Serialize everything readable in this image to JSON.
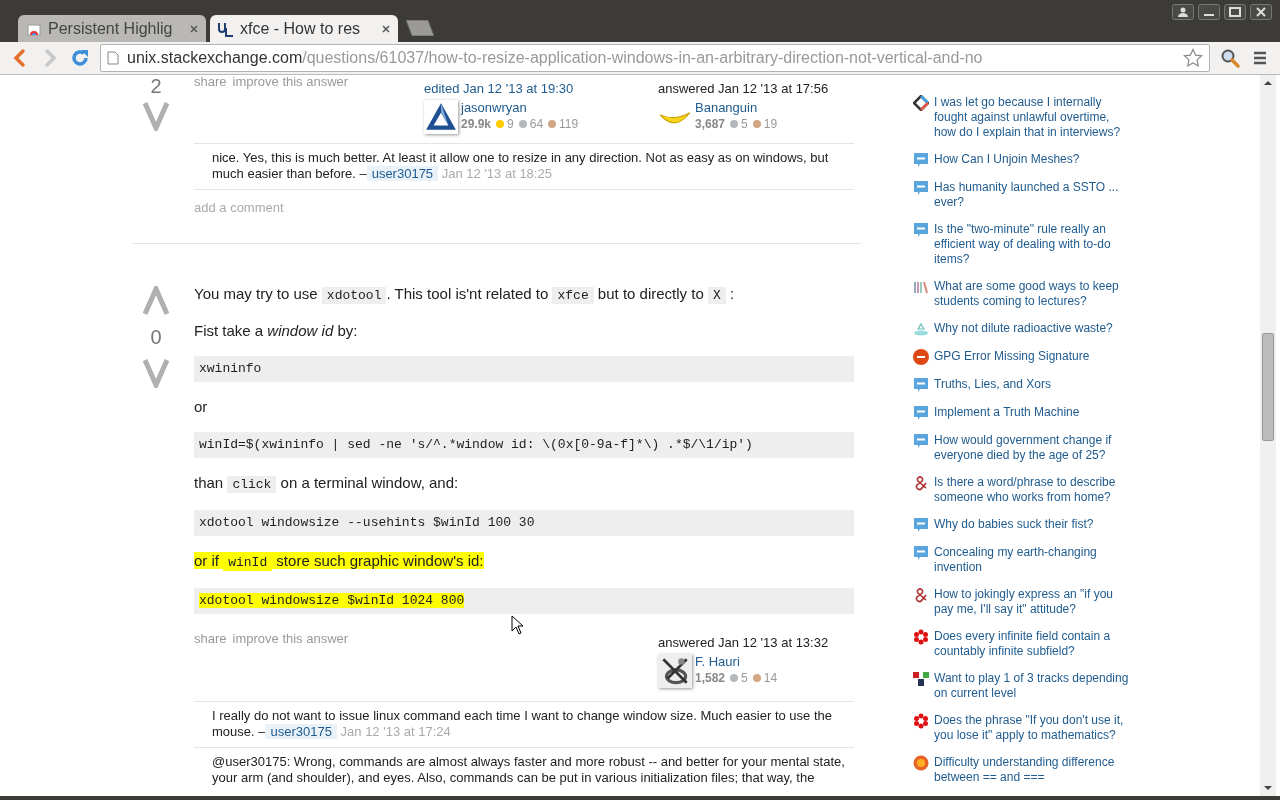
{
  "browser": {
    "tabs": [
      {
        "title": "Persistent Highlig",
        "selected": false
      },
      {
        "title": "xfce - How to res",
        "selected": true
      }
    ],
    "url_host": "unix.stackexchange.com",
    "url_path": "/questions/61037/how-to-resize-application-windows-in-an-arbitrary-direction-not-vertical-and-no"
  },
  "answers": [
    {
      "score": "2",
      "links": [
        "share",
        "improve this answer"
      ],
      "signatures": [
        {
          "action": "edited Jan 12 '13 at 19:30",
          "kind": "edit",
          "user": "jasonwryan",
          "rep": "29.9k",
          "badges": [
            {
              "count": "9",
              "color": "#ffcc01"
            },
            {
              "count": "64",
              "color": "#b4b8bc"
            },
            {
              "count": "119",
              "color": "#d1a684"
            }
          ]
        },
        {
          "action": "answered Jan 12 '13 at 17:56",
          "kind": "answer",
          "user": "Bananguin",
          "rep": "3,687",
          "badges": [
            {
              "count": "5",
              "color": "#b4b8bc"
            },
            {
              "count": "19",
              "color": "#d1a684"
            }
          ]
        }
      ],
      "comments": [
        {
          "text": "nice. Yes, this is much better. At least it allow one to resize in any direction. Not as easy as on windows, but much easier than before. –",
          "user": "user30175",
          "date": "Jan 12 '13 at 18:25"
        }
      ],
      "add_comment": "add a comment"
    },
    {
      "score": "0",
      "links": [
        "share",
        "improve this answer"
      ],
      "blocks": [
        {
          "kind": "para",
          "highlighted": false,
          "parts": [
            {
              "kind": "text",
              "text": "You may try to use "
            },
            {
              "kind": "code",
              "text": "xdotool"
            },
            {
              "kind": "text",
              "text": ". This tool is'nt related to "
            },
            {
              "kind": "code",
              "text": "xfce"
            },
            {
              "kind": "text",
              "text": " but to directly to "
            },
            {
              "kind": "code",
              "text": "X"
            },
            {
              "kind": "text",
              "text": " :"
            }
          ]
        },
        {
          "kind": "para",
          "highlighted": false,
          "parts": [
            {
              "kind": "text",
              "text": "Fist take a "
            },
            {
              "kind": "em",
              "text": "window id"
            },
            {
              "kind": "text",
              "text": " by:"
            }
          ]
        },
        {
          "kind": "code",
          "highlighted": false,
          "text": "xwininfo"
        },
        {
          "kind": "para",
          "highlighted": false,
          "parts": [
            {
              "kind": "text",
              "text": "or"
            }
          ]
        },
        {
          "kind": "code",
          "highlighted": false,
          "text": "winId=$(xwininfo | sed -ne 's/^.*window id: \\(0x[0-9a-f]*\\) .*$/\\1/ip')"
        },
        {
          "kind": "para",
          "highlighted": false,
          "parts": [
            {
              "kind": "text",
              "text": "than "
            },
            {
              "kind": "code",
              "text": "click"
            },
            {
              "kind": "text",
              "text": " on a terminal window, and:"
            }
          ]
        },
        {
          "kind": "code",
          "highlighted": false,
          "text": "xdotool windowsize --usehints $winId 100 30"
        },
        {
          "kind": "para",
          "highlighted": true,
          "parts": [
            {
              "kind": "text",
              "text": "or if "
            },
            {
              "kind": "code",
              "text": "winId"
            },
            {
              "kind": "text",
              "text": " store such graphic window's id:"
            }
          ]
        },
        {
          "kind": "code",
          "highlighted": true,
          "text": "xdotool windowsize $winId 1024 800"
        }
      ],
      "signatures": [
        {
          "action": "answered Jan 12 '13 at 13:32",
          "kind": "answer",
          "user": "F. Hauri",
          "rep": "1,582",
          "badges": [
            {
              "count": "5",
              "color": "#b4b8bc"
            },
            {
              "count": "14",
              "color": "#d1a684"
            }
          ]
        }
      ],
      "comments": [
        {
          "text": "I really do not want to issue linux command each time I want to change window size. Much easier to use the mouse. –",
          "user": "user30175",
          "date": "Jan 12 '13 at 17:24"
        },
        {
          "text": "@user30175: Wrong, commands are almost always faster and more robust -- and better for your mental state, your arm (and shoulder), and eyes. Also, commands can be put in various initialization files; that way, the"
        }
      ]
    }
  ],
  "hot_questions": [
    {
      "title": "I was let go because I internally fought against unlawful overtime, how do I explain that in interviews?",
      "kind": "diamond"
    },
    {
      "title": "How Can I Unjoin Meshes?",
      "kind": "bubble"
    },
    {
      "title": "Has humanity launched a SSTO ... ever?",
      "kind": "bubble"
    },
    {
      "title": "Is the \"two-minute\" rule really an efficient way of dealing with to-do items?",
      "kind": "bubble"
    },
    {
      "title": "What are some good ways to keep students coming to lectures?",
      "kind": "books"
    },
    {
      "title": "Why not dilute radioactive waste?",
      "kind": "drop"
    },
    {
      "title": "GPG Error Missing Signature",
      "kind": "circle"
    },
    {
      "title": "Truths, Lies, and Xors",
      "kind": "bubble"
    },
    {
      "title": "Implement a Truth Machine",
      "kind": "bubble"
    },
    {
      "title": "How would government change if everyone died by the age of 25?",
      "kind": "bubble"
    },
    {
      "title": "Is there a word/phrase to describe someone who works from home?",
      "kind": "ampersand"
    },
    {
      "title": "Why do babies suck their fist?",
      "kind": "bubble"
    },
    {
      "title": "Concealing my earth-changing invention",
      "kind": "bubble"
    },
    {
      "title": "How to jokingly express an \"if you pay me, I'll say it\" attitude?",
      "kind": "ampersand"
    },
    {
      "title": "Does every infinite field contain a countably infinite subfield?",
      "kind": "flower"
    },
    {
      "title": "Want to play 1 of 3 tracks depending on current level",
      "kind": "cubes"
    },
    {
      "title": "Does the phrase \"If you don't use it, you lose it\" apply to mathematics?",
      "kind": "flower"
    },
    {
      "title": "Difficulty understanding difference between == and ===",
      "kind": "sun"
    }
  ]
}
